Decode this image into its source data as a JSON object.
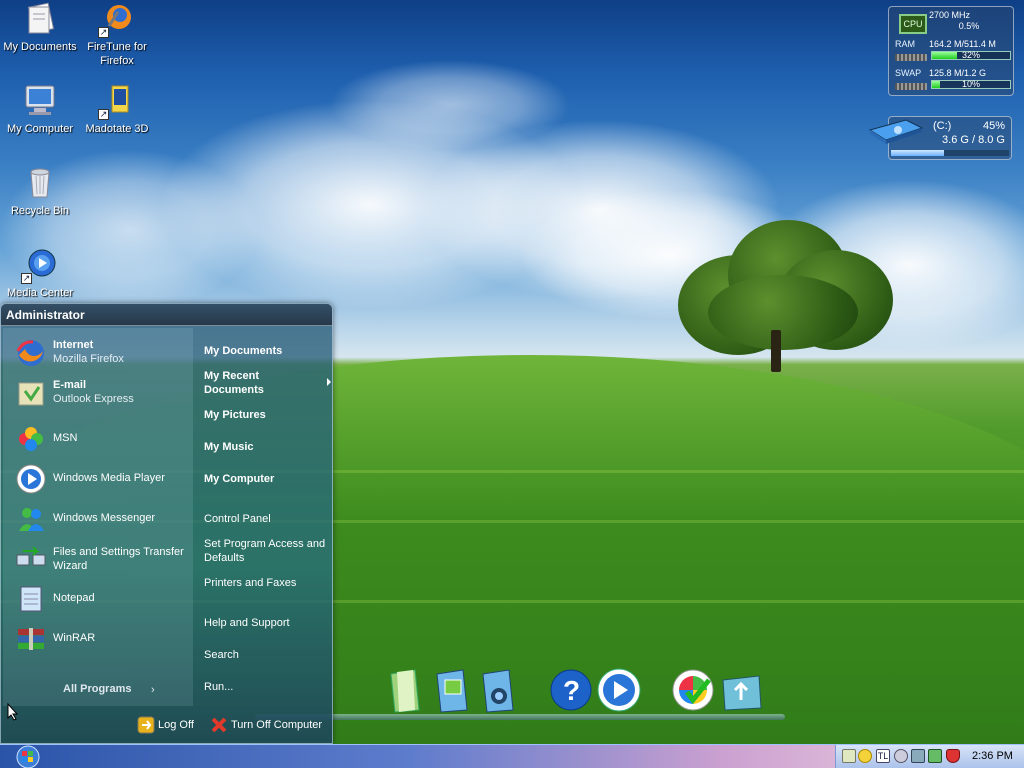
{
  "desktop": {
    "icons": [
      {
        "label": "My Documents",
        "icon": "documents-icon"
      },
      {
        "label": "FireTune for Firefox",
        "icon": "firetune-icon"
      },
      {
        "label": "My Computer",
        "icon": "computer-icon"
      },
      {
        "label": "Madotate 3D",
        "icon": "madotate-icon"
      },
      {
        "label": "Recycle Bin",
        "icon": "recycle-bin-icon"
      },
      {
        "label": "Media Center",
        "icon": "media-center-icon"
      }
    ]
  },
  "system_monitor": {
    "cpu": {
      "label": "CPU",
      "freq": "2700 MHz",
      "percent_text": "0.5%",
      "fraction": 0.005
    },
    "ram": {
      "label": "RAM",
      "usage": "164.2 M/511.4 M",
      "percent_text": "32%",
      "fraction": 0.32
    },
    "swap": {
      "label": "SWAP",
      "usage": "125.8 M/1.2 G",
      "percent_text": "10%",
      "fraction": 0.1
    }
  },
  "drive": {
    "name": "(C:)",
    "percent_text": "45%",
    "size": "3.6 G / 8.0 G",
    "fraction": 0.45
  },
  "start_menu": {
    "user": "Administrator",
    "pinned": [
      {
        "title": "Internet",
        "subtitle": "Mozilla Firefox",
        "icon": "firefox-icon"
      },
      {
        "title": "E-mail",
        "subtitle": "Outlook Express",
        "icon": "email-icon"
      }
    ],
    "recent": [
      {
        "label": "MSN",
        "icon": "msn-icon"
      },
      {
        "label": "Windows Media Player",
        "icon": "media-player-icon"
      },
      {
        "label": "Windows Messenger",
        "icon": "messenger-icon"
      },
      {
        "label": "Files and Settings Transfer Wizard",
        "icon": "transfer-wizard-icon"
      },
      {
        "label": "Notepad",
        "icon": "notepad-icon"
      },
      {
        "label": "WinRAR",
        "icon": "winrar-icon"
      }
    ],
    "all_programs": "All Programs",
    "places": [
      {
        "label": "My Documents",
        "bold": true
      },
      {
        "label": "My Recent Documents",
        "bold": true,
        "submenu": true
      },
      {
        "label": "My Pictures",
        "bold": true
      },
      {
        "label": "My Music",
        "bold": true
      },
      {
        "label": "My Computer",
        "bold": true
      },
      {
        "label": "Control Panel",
        "bold": false
      },
      {
        "label": "Set Program Access and Defaults",
        "bold": false
      },
      {
        "label": "Printers and Faxes",
        "bold": false
      },
      {
        "label": "Help and Support",
        "bold": false
      },
      {
        "label": "Search",
        "bold": false
      },
      {
        "label": "Run...",
        "bold": false
      }
    ],
    "log_off": "Log Off",
    "turn_off": "Turn Off Computer"
  },
  "dock": [
    "folder-icon",
    "pictures-folder-icon",
    "music-folder-icon",
    "help-icon",
    "media-player-icon",
    "windows-update-icon",
    "recycle-icon"
  ],
  "taskbar": {
    "clock": "2:36 PM",
    "tray_icons": [
      "flag-icon",
      "smiley-icon",
      "language-icon",
      "volume-icon",
      "network-icon",
      "safely-remove-icon",
      "security-icon"
    ]
  },
  "colors": {
    "accent": "#2a54a8",
    "start_menu": "#2f6a7c",
    "sky": "#1e5fae",
    "grass": "#3f8d20"
  }
}
